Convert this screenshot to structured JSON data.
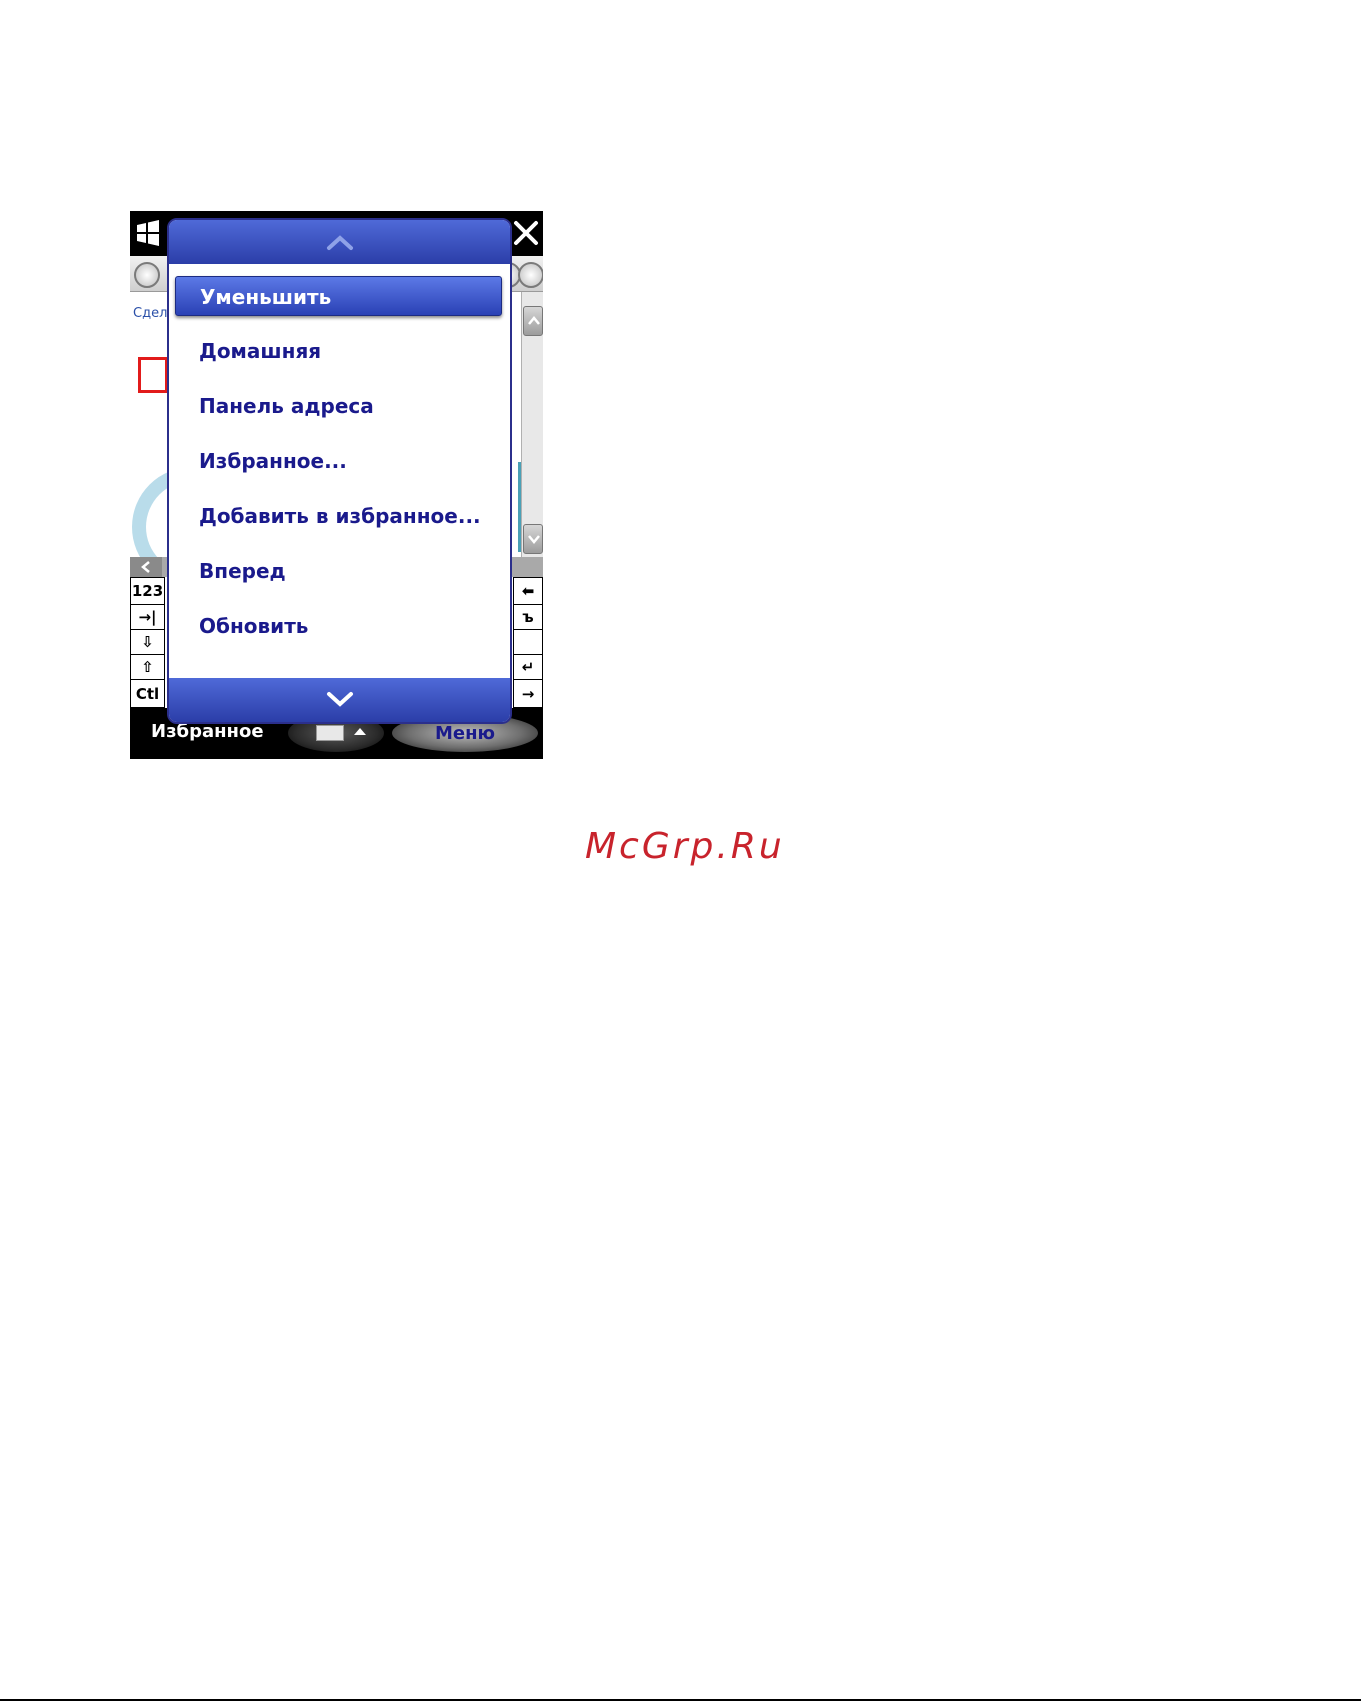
{
  "watermark": "McGrp.Ru",
  "web": {
    "link_text": "Сдел"
  },
  "keyboard": {
    "left_keys": [
      "123",
      "→|",
      "⇩",
      "⇧",
      "Ctl"
    ],
    "right_keys": [
      "⬅",
      "ъ",
      "",
      "↵",
      "→"
    ]
  },
  "popup_menu": {
    "items": [
      {
        "label": "Уменьшить",
        "selected": true
      },
      {
        "label": "Домашняя",
        "selected": false
      },
      {
        "label": "Панель адреса",
        "selected": false
      },
      {
        "label": "Избранное...",
        "selected": false
      },
      {
        "label": "Добавить в избранное...",
        "selected": false
      },
      {
        "label": "Вперед",
        "selected": false
      },
      {
        "label": "Обновить",
        "selected": false
      }
    ]
  },
  "softkeys": {
    "left": "Избранное",
    "right": "Меню"
  },
  "colors": {
    "menu_text": "#1a1a8c",
    "menu_header": "#2b3ea8",
    "selected_bg": "#3a52c8",
    "watermark": "#c8232c"
  },
  "icons": [
    "windows-logo-icon",
    "close-icon",
    "chevron-up-icon",
    "chevron-down-icon",
    "keyboard-icon",
    "caret-up-icon"
  ]
}
